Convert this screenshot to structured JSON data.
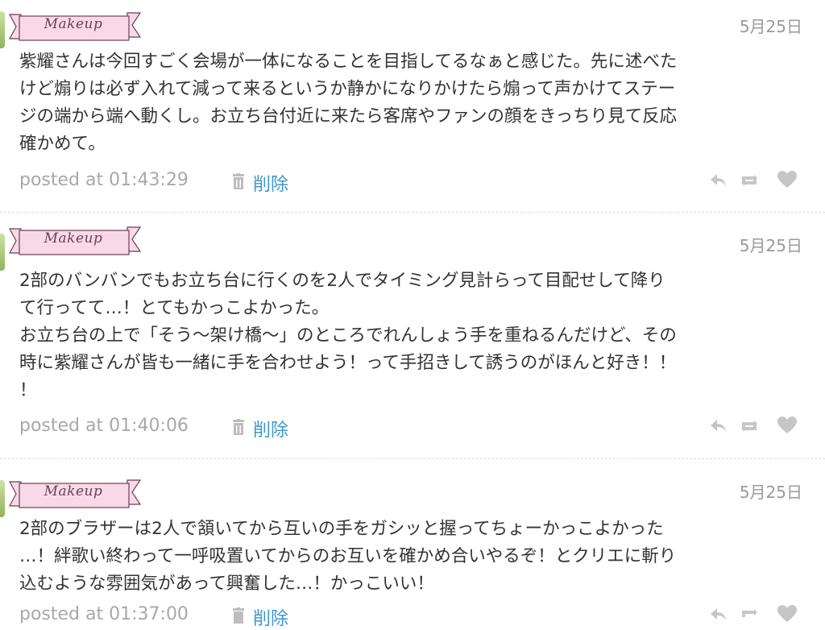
{
  "colors": {
    "ribbon_fill": "#f9d9e8",
    "ribbon_stroke": "#6b3f58",
    "link": "#3f97c8",
    "meta_gray": "#a8a8a8",
    "text": "#333333"
  },
  "labels": {
    "posted_prefix": "posted at",
    "delete": "削除"
  },
  "icons": [
    "trash-icon",
    "reply-icon",
    "retweet-icon",
    "heart-icon"
  ],
  "posts": [
    {
      "stamp": "Makeup",
      "date": "5月25日",
      "lines": [
        "紫耀さんは今回すごく会場が一体になることを目指してるなぁと感じた。先に述べた",
        "けど煽りは必ず入れて減って来るというか静かになりかけたら煽って声かけてステー",
        "ジの端から端へ動くし。お立ち台付近に来たら客席やファンの顔をきっちり見て反応",
        "確かめて。"
      ],
      "time": "01:43:29"
    },
    {
      "stamp": "Makeup",
      "date": "5月25日",
      "lines": [
        "2部のバンバンでもお立ち台に行くのを2人でタイミング見計らって目配せして降り",
        "て行ってて…！とてもかっこよかった。",
        "お立ち台の上で「そう〜架け橋〜」のところでれんしょう手を重ねるんだけど、その",
        "時に紫耀さんが皆も一緒に手を合わせよう！って手招きして誘うのがほんと好き！！",
        "！"
      ],
      "time": "01:40:06"
    },
    {
      "stamp": "Makeup",
      "date": "5月25日",
      "lines": [
        "2部のブラザーは2人で頷いてから互いの手をガシッと握ってちょーかっこよかった",
        "…！絆歌い終わって一呼吸置いてからのお互いを確かめ合いやるぞ！とクリエに斬り",
        "込むような雰囲気があって興奮した…！かっこいい！"
      ],
      "time": "01:37:00"
    }
  ]
}
